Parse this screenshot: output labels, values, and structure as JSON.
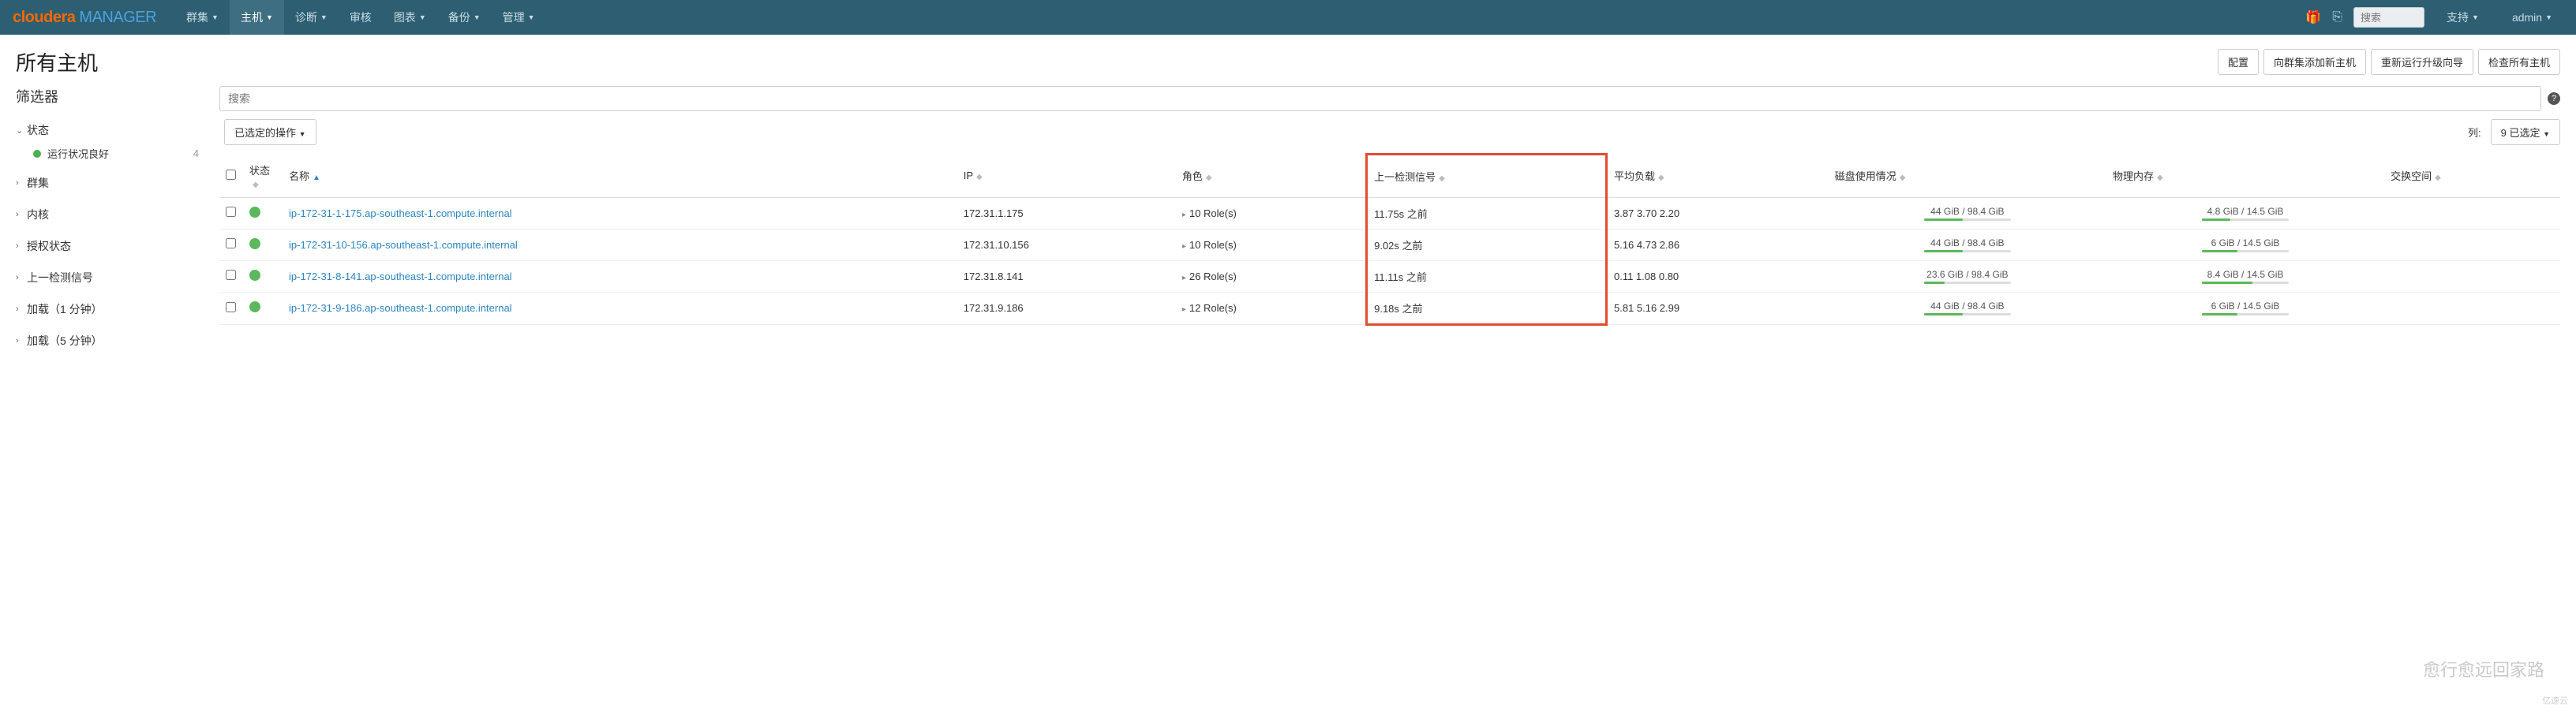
{
  "brand": {
    "p1": "cloudera",
    "p2": " MANAGER"
  },
  "nav": {
    "items": [
      {
        "label": "群集"
      },
      {
        "label": "主机",
        "active": true
      },
      {
        "label": "诊断"
      },
      {
        "label": "审核",
        "nocaret": true
      },
      {
        "label": "图表"
      },
      {
        "label": "备份"
      },
      {
        "label": "管理"
      }
    ],
    "search_placeholder": "搜索",
    "support": "支持",
    "user": "admin"
  },
  "header": {
    "title": "所有主机",
    "buttons": {
      "config": "配置",
      "add_host": "向群集添加新主机",
      "rerun_upgrade": "重新运行升级向导",
      "inspect": "检查所有主机"
    }
  },
  "filter": {
    "title": "筛选器",
    "groups": {
      "status": {
        "label": "状态",
        "open": true,
        "sub_label": "运行状况良好",
        "count": "4"
      },
      "cluster": {
        "label": "群集"
      },
      "kernel": {
        "label": "内核"
      },
      "auth": {
        "label": "授权状态"
      },
      "last_signal": {
        "label": "上一检测信号"
      },
      "load1": {
        "label": "加载（1 分钟）"
      },
      "load5": {
        "label": "加载（5 分钟）"
      }
    }
  },
  "content": {
    "search_placeholder": "搜索",
    "ops_btn": "已选定的操作",
    "cols_label": "列:",
    "cols_btn": "9 已选定"
  },
  "table": {
    "headers": {
      "status": "状态",
      "name": "名称",
      "ip": "IP",
      "roles": "角色",
      "signal": "上一检测信号",
      "load": "平均负载",
      "disk": "磁盘使用情况",
      "mem": "物理内存",
      "swap": "交换空间"
    },
    "rows": [
      {
        "name": "ip-172-31-1-175.ap-southeast-1.compute.internal",
        "ip": "172.31.1.175",
        "roles": "10 Role(s)",
        "signal": "11.75s 之前",
        "load": "3.87  3.70  2.20",
        "disk": "44 GiB / 98.4 GiB",
        "disk_pct": 45,
        "mem": "4.8 GiB / 14.5 GiB",
        "mem_pct": 33
      },
      {
        "name": "ip-172-31-10-156.ap-southeast-1.compute.internal",
        "ip": "172.31.10.156",
        "roles": "10 Role(s)",
        "signal": "9.02s 之前",
        "load": "5.16  4.73  2.86",
        "disk": "44 GiB / 98.4 GiB",
        "disk_pct": 45,
        "mem": "6 GiB / 14.5 GiB",
        "mem_pct": 41
      },
      {
        "name": "ip-172-31-8-141.ap-southeast-1.compute.internal",
        "ip": "172.31.8.141",
        "roles": "26 Role(s)",
        "signal": "11.11s 之前",
        "load": "0.11  1.08  0.80",
        "disk": "23.6 GiB / 98.4 GiB",
        "disk_pct": 24,
        "mem": "8.4 GiB / 14.5 GiB",
        "mem_pct": 58
      },
      {
        "name": "ip-172-31-9-186.ap-southeast-1.compute.internal",
        "ip": "172.31.9.186",
        "roles": "12 Role(s)",
        "signal": "9.18s 之前",
        "load": "5.81  5.16  2.99",
        "disk": "44 GiB / 98.4 GiB",
        "disk_pct": 45,
        "mem": "6 GiB / 14.5 GiB",
        "mem_pct": 41
      }
    ]
  },
  "watermark": "愈行愈远回家路",
  "watermark2": "亿速云"
}
